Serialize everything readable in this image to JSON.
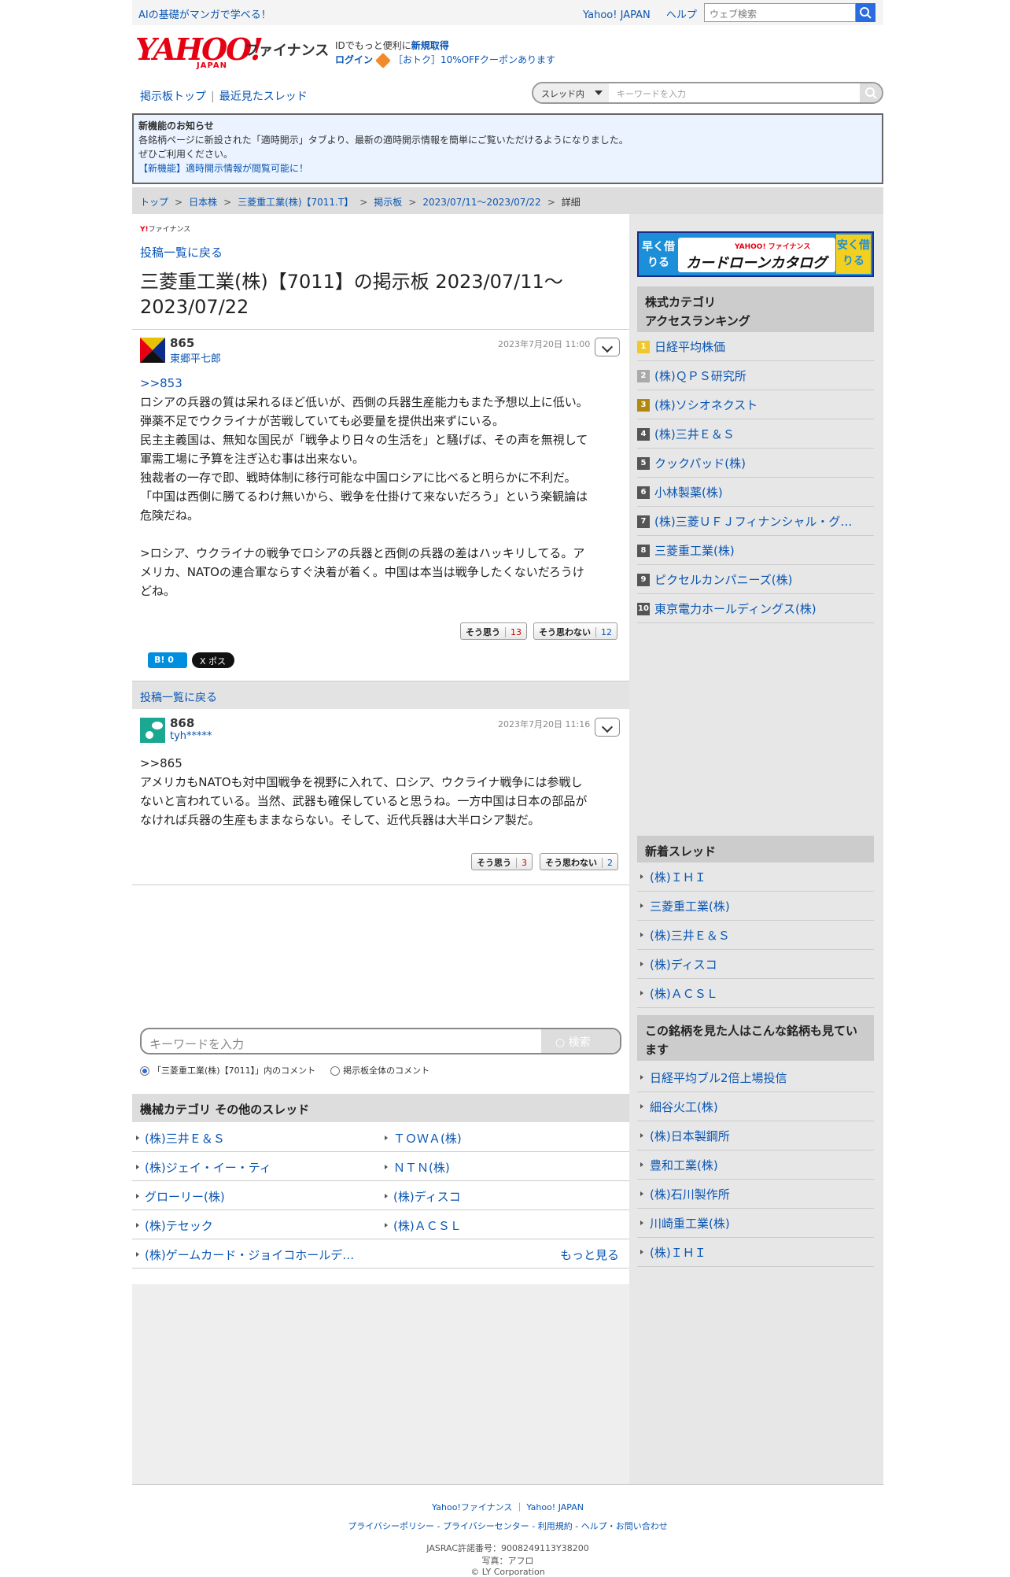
{
  "topbar": {
    "promo": "AIの基礎がマンガで学べる！",
    "links": [
      "Yahoo! JAPAN",
      "ヘルプ"
    ],
    "search_placeholder": "ウェブ検索"
  },
  "header": {
    "logo_yahoo": "YAHOO!",
    "logo_japan": "JAPAN",
    "logo_finance": "ファイナンス",
    "id_text": "IDでもっと便利に",
    "signup": "新規取得",
    "login": "ログイン",
    "coupon": "［おトク］10%OFFクーポンあります"
  },
  "boardnav": {
    "top": "掲示板トップ",
    "recent": "最近見たスレッド",
    "scope": "スレッド内",
    "keyword_placeholder": "キーワードを入力"
  },
  "notice": {
    "title": "新機能のお知らせ",
    "line1": "各銘柄ページに新設された「適時開示」タブより、最新の適時開示情報を簡単にご覧いただけるようになりました。",
    "line2": "ぜひご利用ください。",
    "link": "【新機能】適時開示情報が閲覧可能に！"
  },
  "breadcrumb": [
    "トップ",
    "日本株",
    "三菱重工業(株)【7011.T】",
    "掲示板",
    "2023/07/11〜2023/07/22",
    "詳細"
  ],
  "main": {
    "yfin": "ファイナンス",
    "back": "投稿一覧に戻る",
    "title": "三菱重工業(株)【7011】の掲示板 2023/07/11〜2023/07/22"
  },
  "posts": [
    {
      "num": "865",
      "user": "東郷平七郎",
      "date": "2023年7月20日 11:00",
      "reply": ">>853",
      "lines": [
        "ロシアの兵器の質は呆れるほど低いが、西側の兵器生産能力もまた予想以上に低い。",
        "弾薬不足でウクライナが苦戦していても必要量を提供出来ずにいる。",
        "民主主義国は、無知な国民が「戦争より日々の生活を」と騒げば、その声を無視して",
        "軍需工場に予算を注ぎ込む事は出来ない。",
        "独裁者の一存で即、戦時体制に移行可能な中国ロシアに比べると明らかに不利だ。",
        "「中国は西側に勝てるわけ無いから、戦争を仕掛けて来ないだろう」という楽観論は",
        "危険だね。",
        "",
        ">ロシア、ウクライナの戦争でロシアの兵器と西側の兵器の差はハッキリしてる。ア",
        "メリカ、NATOの連合軍ならすぐ決着が着く。中国は本当は戦争したくないだろうけ",
        "どね。"
      ],
      "agree_label": "そう思う",
      "agree": "13",
      "disagree_label": "そう思わない",
      "disagree": "12",
      "hatena": "B! 0",
      "x": "X ポスト"
    },
    {
      "num": "868",
      "user": "tyh*****",
      "date": "2023年7月20日 11:16",
      "reply": ">>865",
      "lines": [
        "アメリカもNATOも対中国戦争を視野に入れて、ロシア、ウクライナ戦争には参戦し",
        "ないと言われている。当然、武器も確保していると思うね。一方中国は日本の部品が",
        "なければ兵器の生産もままならない。そして、近代兵器は大半ロシア製だ。"
      ],
      "agree_label": "そう思う",
      "agree": "3",
      "disagree_label": "そう思わない",
      "disagree": "2"
    }
  ],
  "bottom_search": {
    "placeholder": "キーワードを入力",
    "button": "検索",
    "radio1": "「三菱重工業(株)【7011】」内のコメント",
    "radio2": "掲示板全体のコメント"
  },
  "other_threads": {
    "title": "機械カテゴリ その他のスレッド",
    "items": [
      "(株)三井Ｅ＆Ｓ",
      "ＴＯＷＡ(株)",
      "(株)ジェイ・イー・ティ",
      "ＮＴＮ(株)",
      "グローリー(株)",
      "(株)ディスコ",
      "(株)テセック",
      "(株)ＡＣＳＬ",
      "(株)ゲームカード・ジョイコホールデ…"
    ],
    "more": "もっと見る"
  },
  "sidebar": {
    "banner_top": "YAHOO! ファイナンス",
    "banner_main": "カードローンカタログ",
    "banner_left": "早く借りる",
    "banner_right": "安く借りる",
    "ranking_title1": "株式カテゴリ",
    "ranking_title2": "アクセスランキング",
    "ranking": [
      "日経平均株価",
      "(株)ＱＰＳ研究所",
      "(株)ソシオネクスト",
      "(株)三井Ｅ＆Ｓ",
      "クックパッド(株)",
      "小林製薬(株)",
      "(株)三菱ＵＦＪフィナンシャル・グ…",
      "三菱重工業(株)",
      "ピクセルカンパニーズ(株)",
      "東京電力ホールディングス(株)"
    ],
    "new_title": "新着スレッド",
    "new_threads": [
      "(株)ＩＨＩ",
      "三菱重工業(株)",
      "(株)三井Ｅ＆Ｓ",
      "(株)ディスコ",
      "(株)ＡＣＳＬ"
    ],
    "also_title": "この銘柄を見た人はこんな銘柄も見ています",
    "also": [
      "日経平均ブル2倍上場投信",
      "細谷火工(株)",
      "(株)日本製鋼所",
      "豊和工業(株)",
      "(株)石川製作所",
      "川崎重工業(株)",
      "(株)ＩＨＩ"
    ]
  },
  "footer": {
    "links1": [
      "Yahoo!ファイナンス",
      "Yahoo! JAPAN"
    ],
    "links2": [
      "プライバシーポリシー",
      "プライバシーセンター",
      "利用規約",
      "ヘルプ・お問い合わせ"
    ],
    "jasrac": "JASRAC許諾番号：9008249113Y38200",
    "photo": "写真：アフロ",
    "copyright": "© LY Corporation"
  }
}
